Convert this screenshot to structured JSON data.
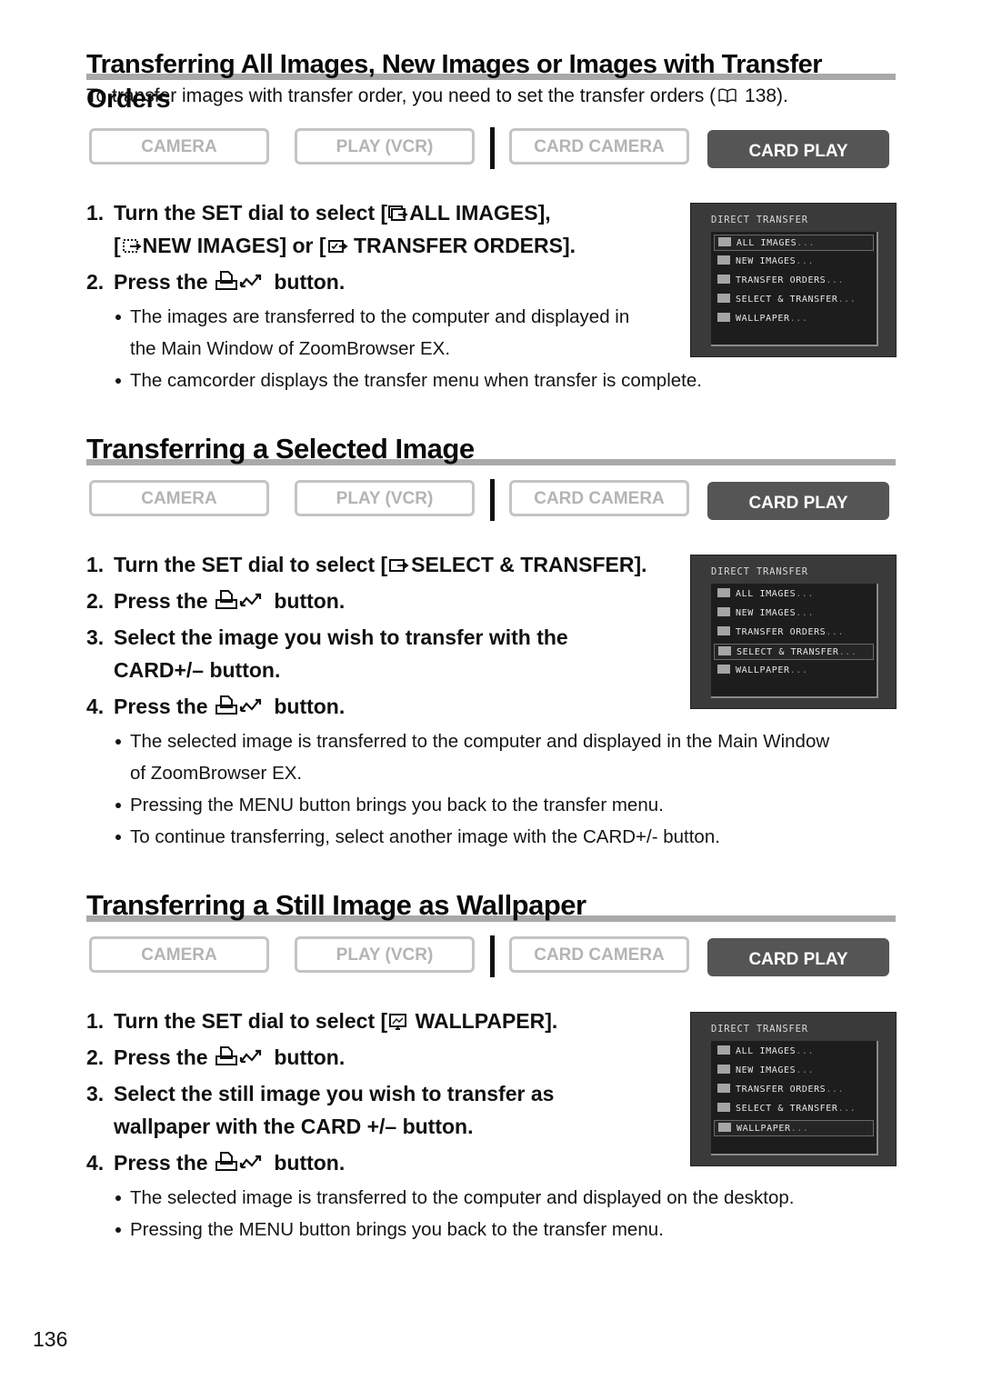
{
  "page_number": "136",
  "mode_buttons": [
    "CAMERA",
    "PLAY (VCR)",
    "CARD CAMERA",
    "CARD PLAY"
  ],
  "active_mode": "CARD PLAY",
  "colors": {
    "active_mode_bg": "#555555",
    "inactive_mode_text": "#b4b4b4",
    "title_rule": "#a9a9a9",
    "screen_bg": "#3a3a3a"
  },
  "button_icon": "print-share-icon",
  "screen": {
    "header": "DIRECT TRANSFER",
    "items": [
      "ALL IMAGES",
      "NEW IMAGES",
      "TRANSFER ORDERS",
      "SELECT & TRANSFER",
      "WALLPAPER"
    ],
    "ellipsis": "..."
  },
  "sections": [
    {
      "title": "Transferring All Images, New Images or Images with Transfer Orders",
      "intro": "To transfer images with transfer order, you need to set the transfer orders (",
      "intro_ref": "138).",
      "steps": [
        {
          "num": "1.",
          "text_a": "Turn the SET dial to select [",
          "label_a": "ALL IMAGES],",
          "text_b": "[",
          "label_b": "NEW IMAGES] or [",
          "label_c": "TRANSFER ORDERS]."
        },
        {
          "num": "2.",
          "pre": "Press the",
          "post": "button."
        }
      ],
      "bullets": [
        "The images are transferred to the computer and displayed in",
        "the Main Window of ZoomBrowser EX.",
        "The camcorder displays the transfer menu when transfer is complete."
      ],
      "screen_selected": "ALL IMAGES"
    },
    {
      "title": "Transferring a Selected Image",
      "steps": [
        {
          "num": "1.",
          "pre": "Turn the SET dial to select [",
          "label": "SELECT & TRANSFER]."
        },
        {
          "num": "2.",
          "pre": "Press the",
          "post": "button."
        },
        {
          "num": "3.",
          "line1": "Select the image you wish to transfer with the",
          "line2": "CARD+/– button."
        },
        {
          "num": "4.",
          "pre": "Press the",
          "post": "button."
        }
      ],
      "bullets": [
        "The selected image is transferred to the computer and displayed in the Main Window",
        "of ZoomBrowser EX.",
        "Pressing the MENU button brings you back to the transfer menu.",
        "To continue transferring, select another image with the CARD+/- button."
      ],
      "screen_selected": "SELECT & TRANSFER"
    },
    {
      "title": "Transferring a Still Image as Wallpaper",
      "steps": [
        {
          "num": "1.",
          "pre": "Turn the SET dial to select [",
          "label": "WALLPAPER]."
        },
        {
          "num": "2.",
          "pre": "Press the",
          "post": "button."
        },
        {
          "num": "3.",
          "line1": "Select the still image you wish to transfer as",
          "line2": "wallpaper with the CARD +/– button."
        },
        {
          "num": "4.",
          "pre": "Press the",
          "post": "button."
        }
      ],
      "bullets": [
        "The selected image is transferred to the computer and displayed on the desktop.",
        "Pressing the MENU button brings you back to the transfer menu."
      ],
      "screen_selected": "WALLPAPER"
    }
  ]
}
